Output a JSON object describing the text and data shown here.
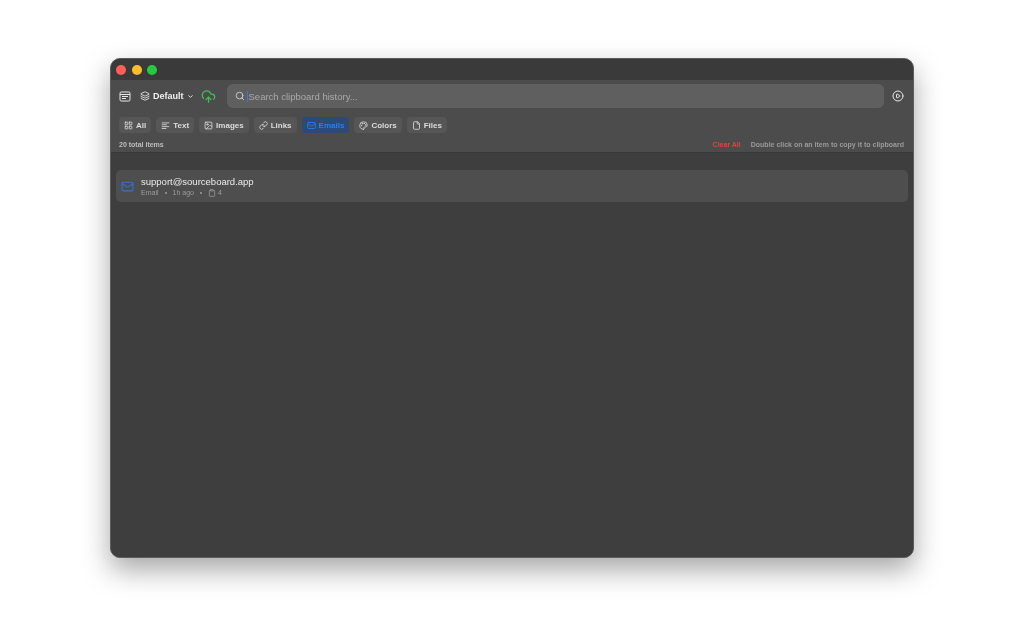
{
  "toolbar": {
    "profile": "Default",
    "search": {
      "placeholder": "Search clipboard history...",
      "focused": true
    }
  },
  "filters": [
    {
      "kind": "all",
      "label": "All",
      "selected": false
    },
    {
      "kind": "text",
      "label": "Text",
      "selected": false
    },
    {
      "kind": "images",
      "label": "Images",
      "selected": false
    },
    {
      "kind": "links",
      "label": "Links",
      "selected": false
    },
    {
      "kind": "emails",
      "label": "Emails",
      "selected": true
    },
    {
      "kind": "colors",
      "label": "Colors",
      "selected": false
    },
    {
      "kind": "files",
      "label": "Files",
      "selected": false
    }
  ],
  "status_bar": {
    "count": "20 total items",
    "clear_button": "Clear All",
    "hint": "Double click on an item to copy it to clipboard"
  },
  "items": [
    {
      "kind": "email",
      "title": "support@sourceboard.app",
      "type": "Email",
      "time": "1h ago",
      "copies": "4"
    }
  ]
}
